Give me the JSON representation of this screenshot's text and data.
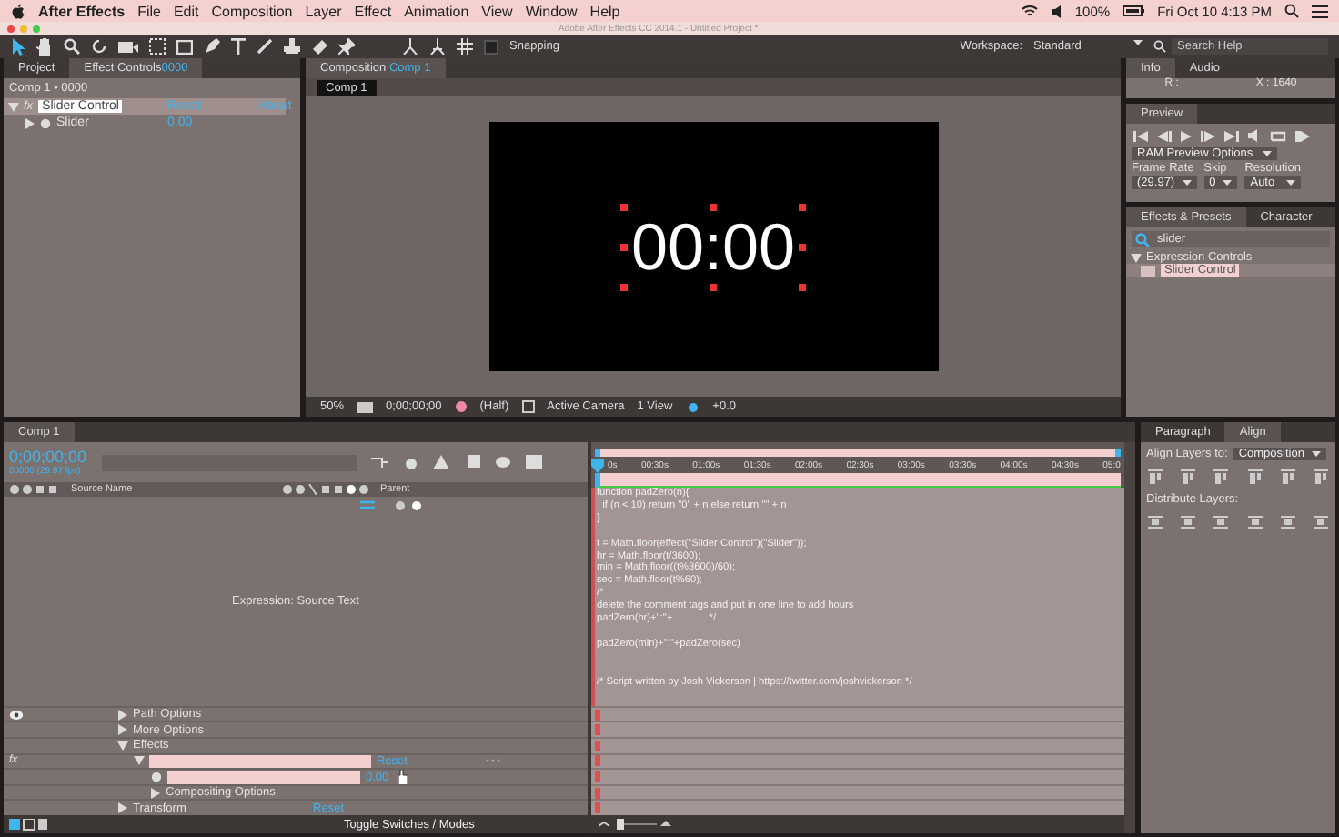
{
  "menu_bar": {
    "app": "After Effects",
    "items": [
      "File",
      "Edit",
      "Composition",
      "Layer",
      "Effect",
      "Animation",
      "View",
      "Window",
      "Help"
    ],
    "battery": "100%",
    "clock": "Fri Oct 10  4:13 PM"
  },
  "window": {
    "title": "Adobe After Effects CC 2014.1 - Untitled Project *"
  },
  "toolbar": {
    "snapping": {
      "label": "Snapping",
      "checked": false
    },
    "workspace_label": "Workspace:",
    "workspace": "Standard",
    "search": {
      "placeholder": "Search Help"
    }
  },
  "left_panel": {
    "tabs": [
      {
        "label": "Project",
        "selected": false
      },
      {
        "label": "Effect Controls",
        "layer": "0000",
        "selected": true
      }
    ],
    "breadcrumb": "Comp 1 • 0000",
    "effect": {
      "icon_text": "fx",
      "name": "Slider Control",
      "expanded": true,
      "reset": "Reset",
      "about": "About",
      "params": [
        {
          "name": "Slider",
          "value": "0.00",
          "expanded": false
        }
      ]
    }
  },
  "composition": {
    "tab_label": "Composition",
    "comp": "Comp 1",
    "viewer_tab": "Comp 1",
    "canvas_text": "00:00",
    "footer": {
      "zoom": "50%",
      "time": "0;00;00;00",
      "resolution": "(Half)",
      "camera": "Active Camera",
      "views": "1 View",
      "exposure": "+0.0"
    }
  },
  "info": {
    "tabs": [
      {
        "label": "Info",
        "selected": true
      },
      {
        "label": "Audio",
        "selected": false
      }
    ],
    "readouts": [
      "R :",
      "X : 1640"
    ]
  },
  "preview": {
    "title": "Preview",
    "options": "RAM Preview Options",
    "fields": [
      {
        "label": "Frame Rate",
        "value": "(29.97)"
      },
      {
        "label": "Skip",
        "value": "0"
      },
      {
        "label": "Resolution",
        "value": "Auto"
      }
    ]
  },
  "effects_presets": {
    "tabs": [
      {
        "label": "Effects & Presets",
        "selected": true
      },
      {
        "label": "Character",
        "selected": false
      }
    ],
    "search": "slider",
    "tree": [
      {
        "label": "Expression Controls",
        "expanded": true,
        "children": [
          {
            "label": "Slider Control",
            "selected": true
          }
        ]
      }
    ]
  },
  "timeline": {
    "tab": "Comp 1",
    "time": "0;00;00;00",
    "frames": "00000 (29.97 fps)",
    "columns": [
      "Source Name",
      "Parent"
    ],
    "expression_label": "Expression: Source Text",
    "properties": [
      {
        "kind": "group",
        "label": "Path Options",
        "expanded": false
      },
      {
        "kind": "group",
        "label": "More Options",
        "expanded": false
      },
      {
        "kind": "group",
        "label": "Effects",
        "expanded": true,
        "children": [
          {
            "kind": "effect",
            "switch": "fx",
            "enabled": true,
            "value": "Reset",
            "expanded": true,
            "children": [
              {
                "kind": "param",
                "value": "0.00"
              },
              {
                "kind": "group",
                "label": "Compositing Options",
                "expanded": false
              }
            ]
          }
        ]
      },
      {
        "kind": "group",
        "label": "Transform",
        "value": "Reset",
        "expanded": false
      }
    ],
    "footer": "Toggle Switches / Modes",
    "ruler": [
      "0s",
      "00:30s",
      "01:00s",
      "01:30s",
      "02:00s",
      "02:30s",
      "03:00s",
      "03:30s",
      "04:00s",
      "04:30s",
      "05:0"
    ],
    "expression": "function padZero(n){\n  if (n < 10) return \"0\" + n else return \"\" + n\n}\n\nt = Math.floor(effect(\"Slider Control\")(\"Slider\"));\nhr = Math.floor(t/3600);\nmin = Math.floor((t%3600)/60);\nsec = Math.floor(t%60);\n/*\ndelete the comment tags and put in one line to add hours\npadZero(hr)+\":\"+             */\n\npadZero(min)+\":\"+padZero(sec)\n\n\n/* Script written by Josh Vickerson | https://twitter.com/joshvickerson */"
  },
  "align": {
    "tabs": [
      {
        "label": "Paragraph",
        "selected": false
      },
      {
        "label": "Align",
        "selected": true
      }
    ],
    "align_to_label": "Align Layers to:",
    "align_to": "Composition",
    "distribute_label": "Distribute Layers:"
  }
}
